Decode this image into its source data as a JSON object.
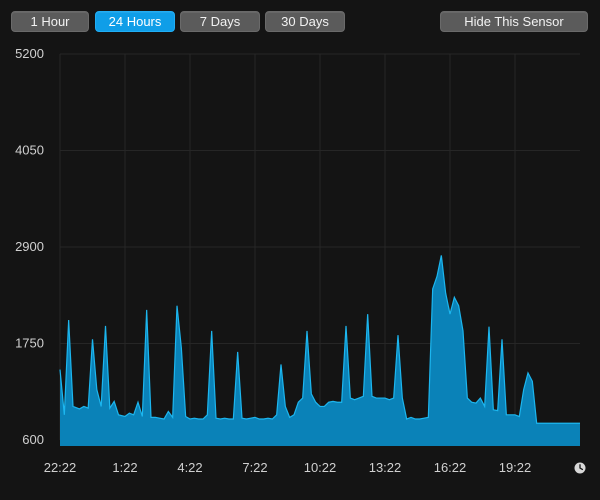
{
  "toolbar": {
    "range_buttons": [
      {
        "label": "1 Hour",
        "active": false
      },
      {
        "label": "24 Hours",
        "active": true
      },
      {
        "label": "7 Days",
        "active": false
      },
      {
        "label": "30 Days",
        "active": false
      }
    ],
    "hide_label": "Hide This Sensor"
  },
  "icons": {
    "clock": "clock-icon"
  },
  "colors": {
    "accent": "#0f9ee8",
    "series_fill": "#0a82b8",
    "series_line": "#1cb6ef",
    "background": "#141414",
    "grid": "#262626"
  },
  "chart_data": {
    "type": "area",
    "title": "",
    "xlabel": "",
    "ylabel": "",
    "ylim": [
      600,
      5200
    ],
    "yticks": [
      600,
      1750,
      2900,
      4050,
      5200
    ],
    "xticks": [
      "22:22",
      "1:22",
      "4:22",
      "7:22",
      "10:22",
      "13:22",
      "16:22",
      "19:22"
    ],
    "grid": true,
    "series": [
      {
        "x": [
          0,
          0.2,
          0.4,
          0.6,
          0.9,
          1.1,
          1.3,
          1.5,
          1.7,
          1.9,
          2.1,
          2.3,
          2.5,
          2.7,
          3.0,
          3.2,
          3.4,
          3.6,
          3.8,
          4.0,
          4.2,
          4.4,
          4.6,
          4.8,
          5.0,
          5.2,
          5.4,
          5.6,
          5.8,
          6.0,
          6.2,
          6.4,
          6.6,
          6.8,
          7.0,
          7.2,
          7.4,
          7.6,
          7.8,
          8.0,
          8.2,
          8.4,
          8.6,
          8.8,
          9.0,
          9.2,
          9.4,
          9.6,
          9.8,
          10.0,
          10.2,
          10.4,
          10.6,
          10.8,
          11.0,
          11.2,
          11.4,
          11.6,
          11.8,
          12.0,
          12.2,
          12.4,
          12.6,
          12.8,
          13.0,
          13.2,
          13.4,
          13.6,
          13.8,
          14.0,
          14.2,
          14.4,
          14.6,
          14.8,
          15.0,
          15.2,
          15.4,
          15.6,
          15.8,
          16.0,
          16.2,
          16.4,
          16.6,
          16.8,
          17.0,
          17.2,
          17.4,
          17.6,
          17.8,
          18.0,
          18.2,
          18.4,
          18.6,
          18.8,
          19.0,
          19.2,
          19.4,
          19.6,
          19.8,
          20.0,
          20.2,
          20.4,
          20.6,
          20.8,
          21.0,
          21.2,
          21.4,
          21.6,
          21.8,
          22.0,
          22.2,
          22.4,
          22.6,
          22.8,
          23.0,
          23.2,
          23.4,
          23.6,
          23.8,
          24.0
        ],
        "values": [
          1440,
          900,
          2030,
          1000,
          970,
          1000,
          980,
          1800,
          1200,
          1000,
          1960,
          980,
          1060,
          900,
          880,
          920,
          900,
          1050,
          880,
          2150,
          870,
          870,
          860,
          850,
          940,
          870,
          2200,
          1700,
          880,
          850,
          860,
          850,
          850,
          900,
          1900,
          860,
          850,
          860,
          850,
          850,
          1650,
          860,
          850,
          860,
          870,
          850,
          850,
          860,
          850,
          900,
          1500,
          1000,
          870,
          900,
          1050,
          1100,
          1900,
          1150,
          1050,
          1000,
          1000,
          1050,
          1060,
          1050,
          1050,
          1960,
          1100,
          1080,
          1100,
          1120,
          2100,
          1120,
          1100,
          1100,
          1100,
          1080,
          1100,
          1850,
          1100,
          850,
          870,
          850,
          850,
          860,
          870,
          2400,
          2550,
          2800,
          2350,
          2100,
          2300,
          2200,
          1900,
          1100,
          1050,
          1040,
          1100,
          1000,
          1950,
          960,
          950,
          1800,
          900,
          900,
          900,
          880,
          1200,
          1400,
          1300,
          800,
          800,
          800,
          800,
          800,
          800,
          800,
          800,
          800,
          800,
          800
        ]
      }
    ]
  }
}
